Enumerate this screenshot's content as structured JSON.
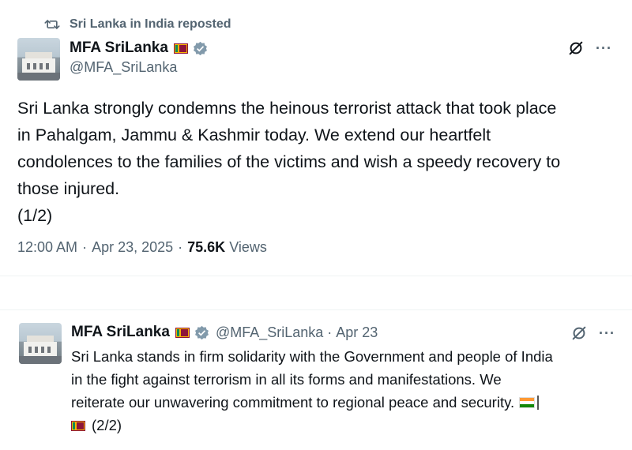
{
  "repost": {
    "label": "Sri Lanka in India reposted",
    "icon": "repost-icon"
  },
  "tweet1": {
    "display_name": "MFA SriLanka",
    "handle": "@MFA_SriLanka",
    "lines": [
      "Sri Lanka strongly condemns the heinous terrorist attack that took place",
      "in Pahalgam, Jammu & Kashmir today. We extend our heartfelt",
      "condolences to the families of the victims and wish a speedy recovery to",
      "those injured.",
      "(1/2)"
    ],
    "time": "12:00 AM",
    "date": "Apr 23, 2025",
    "views_count": "75.6K",
    "views_label": "Views",
    "more": "···"
  },
  "tweet2": {
    "display_name": "MFA SriLanka",
    "handle": "@MFA_SriLanka",
    "date": "Apr 23",
    "lines": [
      "Sri Lanka stands in firm solidarity with the Government and people of India",
      "in the fight against terrorism in all its forms and manifestations. We",
      "reiterate our unwavering commitment to regional peace and security."
    ],
    "last_line": "(2/2)",
    "more": "···"
  },
  "separator": "·",
  "colors": {
    "text": "#0f1419",
    "secondary": "#536471",
    "verified": "#829aab"
  }
}
